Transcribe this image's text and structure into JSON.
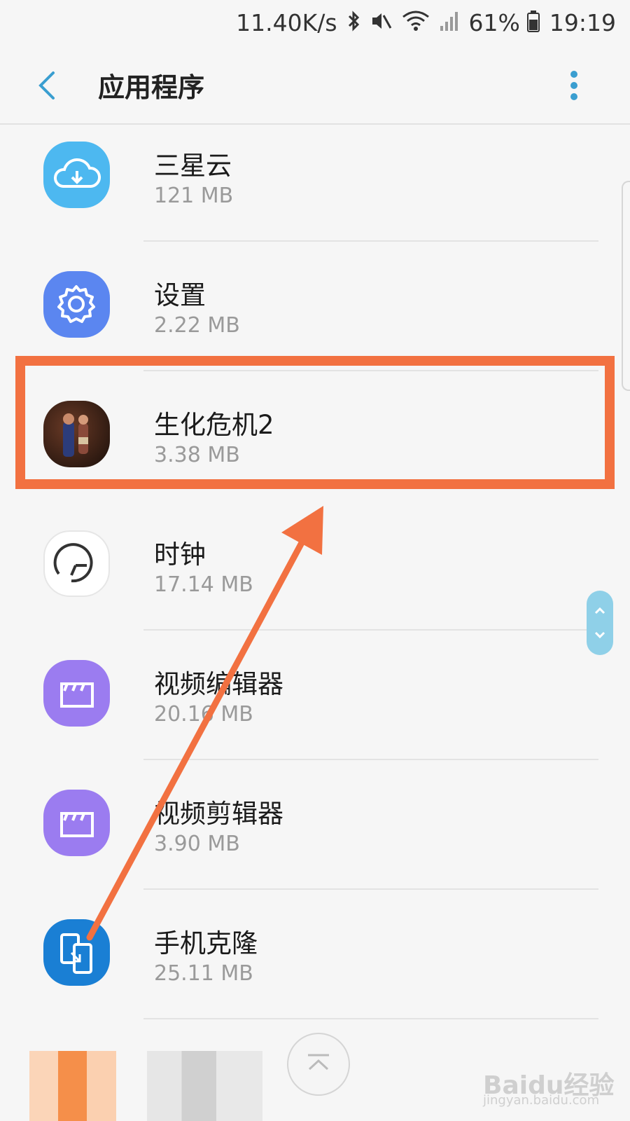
{
  "status_bar": {
    "network_speed": "11.40K/s",
    "battery_percent": "61%",
    "time": "19:19",
    "icons": [
      "bluetooth-icon",
      "mute-icon",
      "wifi-icon",
      "signal-icon",
      "battery-icon"
    ]
  },
  "header": {
    "title": "应用程序",
    "back_icon": "chevron-left-icon",
    "more_icon": "more-vertical-icon"
  },
  "apps": [
    {
      "name": "三星云",
      "size": "121 MB",
      "icon": "cloud-icon",
      "color": "#4db8f0"
    },
    {
      "name": "设置",
      "size": "2.22 MB",
      "icon": "gear-icon",
      "color": "#5b86f0"
    },
    {
      "name": "生化危机2",
      "size": "3.38 MB",
      "icon": "game-icon",
      "color": "#2a1a14"
    },
    {
      "name": "时钟",
      "size": "17.14 MB",
      "icon": "clock-icon",
      "color": "#ffffff"
    },
    {
      "name": "视频编辑器",
      "size": "20.16 MB",
      "icon": "clapper-icon",
      "color": "#9b7cf0"
    },
    {
      "name": "视频剪辑器",
      "size": "3.90 MB",
      "icon": "clapper-icon",
      "color": "#9b7cf0"
    },
    {
      "name": "手机克隆",
      "size": "25.11 MB",
      "icon": "phone-clone-icon",
      "color": "#1a7fd4"
    }
  ],
  "colors": {
    "accent": "#3a9ed0",
    "highlight": "#f27141"
  },
  "watermark": {
    "brand": "Baidu经验",
    "url": "jingyan.baidu.com"
  }
}
